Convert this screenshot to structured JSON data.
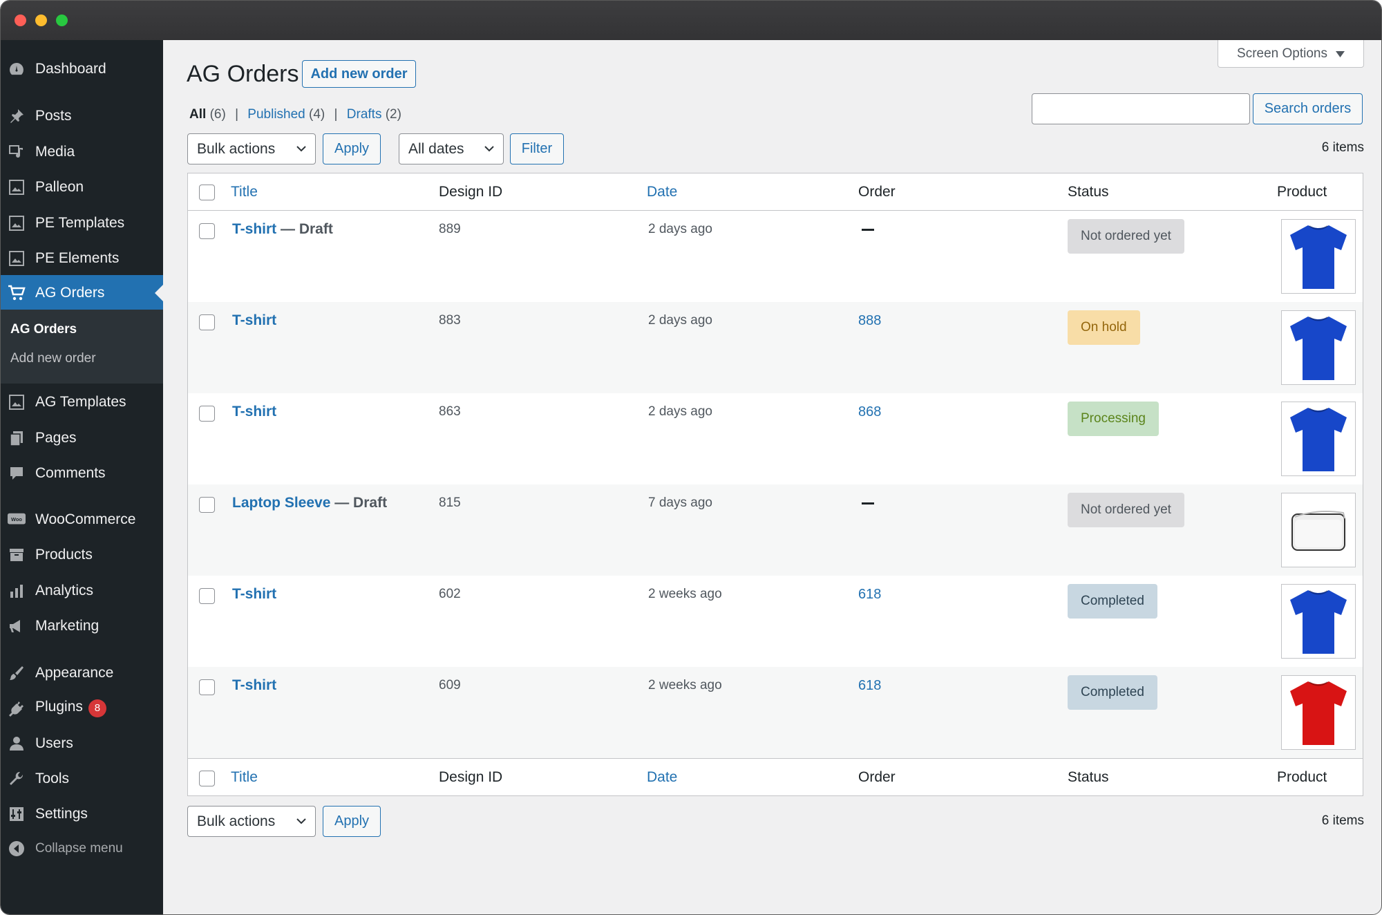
{
  "window": {
    "controls": [
      "close",
      "minimize",
      "zoom"
    ]
  },
  "sidebar": {
    "items": [
      {
        "label": "Dashboard",
        "icon": "dashboard-icon"
      },
      {
        "label": "Posts",
        "icon": "pin-icon"
      },
      {
        "label": "Media",
        "icon": "media-icon"
      },
      {
        "label": "Palleon",
        "icon": "image-icon"
      },
      {
        "label": "PE Templates",
        "icon": "image-icon"
      },
      {
        "label": "PE Elements",
        "icon": "image-icon"
      },
      {
        "label": "AG Orders",
        "icon": "cart-icon",
        "active": true
      },
      {
        "label": "AG Templates",
        "icon": "image-icon"
      },
      {
        "label": "Pages",
        "icon": "pages-icon"
      },
      {
        "label": "Comments",
        "icon": "comment-icon"
      },
      {
        "label": "WooCommerce",
        "icon": "woo-icon"
      },
      {
        "label": "Products",
        "icon": "archive-icon"
      },
      {
        "label": "Analytics",
        "icon": "bar-chart-icon"
      },
      {
        "label": "Marketing",
        "icon": "megaphone-icon"
      },
      {
        "label": "Appearance",
        "icon": "brush-icon"
      },
      {
        "label": "Plugins",
        "icon": "plug-icon",
        "badge": "8"
      },
      {
        "label": "Users",
        "icon": "user-icon"
      },
      {
        "label": "Tools",
        "icon": "wrench-icon"
      },
      {
        "label": "Settings",
        "icon": "settings-icon"
      }
    ],
    "submenu": [
      "AG Orders",
      "Add new order"
    ],
    "collapse_label": "Collapse menu"
  },
  "header": {
    "screen_options": "Screen Options",
    "title": "AG Orders",
    "add_new": "Add new order"
  },
  "views": {
    "all": "All",
    "all_count": "(6)",
    "published": "Published",
    "published_count": "(4)",
    "drafts": "Drafts",
    "drafts_count": "(2)",
    "separator": "|"
  },
  "search": {
    "value": "",
    "button": "Search orders"
  },
  "tablenav_top": {
    "bulk": "Bulk actions",
    "apply": "Apply",
    "dates": "All dates",
    "filter": "Filter",
    "count": "6 items"
  },
  "tablenav_bottom": {
    "bulk": "Bulk actions",
    "apply": "Apply",
    "count": "6 items"
  },
  "columns": {
    "title": "Title",
    "design_id": "Design ID",
    "date": "Date",
    "order": "Order",
    "status": "Status",
    "product": "Product"
  },
  "rows": [
    {
      "title": "T-shirt",
      "draft": " — Draft",
      "design_id": "889",
      "date": "2 days ago",
      "order": "",
      "status": "Not ordered yet",
      "status_bg": "#dcdcde",
      "status_fg": "#50575e",
      "product": "tshirt-blue-icon",
      "color": "#1747c9"
    },
    {
      "title": "T-shirt",
      "draft": "",
      "design_id": "883",
      "date": "2 days ago",
      "order": "888",
      "status": "On hold",
      "status_bg": "#f8dda7",
      "status_fg": "#94660c",
      "product": "tshirt-blue-icon",
      "color": "#1747c9"
    },
    {
      "title": "T-shirt",
      "draft": "",
      "design_id": "863",
      "date": "2 days ago",
      "order": "868",
      "status": "Processing",
      "status_bg": "#c6e1c6",
      "status_fg": "#5b841b",
      "product": "tshirt-blue-icon",
      "color": "#1747c9"
    },
    {
      "title": "Laptop Sleeve",
      "draft": " — Draft",
      "design_id": "815",
      "date": "7 days ago",
      "order": "",
      "status": "Not ordered yet",
      "status_bg": "#dcdcde",
      "status_fg": "#50575e",
      "product": "laptop-sleeve-icon",
      "color": "#f2f2f2"
    },
    {
      "title": "T-shirt",
      "draft": "",
      "design_id": "602",
      "date": "2 weeks ago",
      "order": "618",
      "status": "Completed",
      "status_bg": "#c8d7e1",
      "status_fg": "#2e4453",
      "product": "tshirt-blue-icon",
      "color": "#1747c9"
    },
    {
      "title": "T-shirt",
      "draft": "",
      "design_id": "609",
      "date": "2 weeks ago",
      "order": "618",
      "status": "Completed",
      "status_bg": "#c8d7e1",
      "status_fg": "#2e4453",
      "product": "tshirt-red-icon",
      "color": "#d81414"
    }
  ]
}
